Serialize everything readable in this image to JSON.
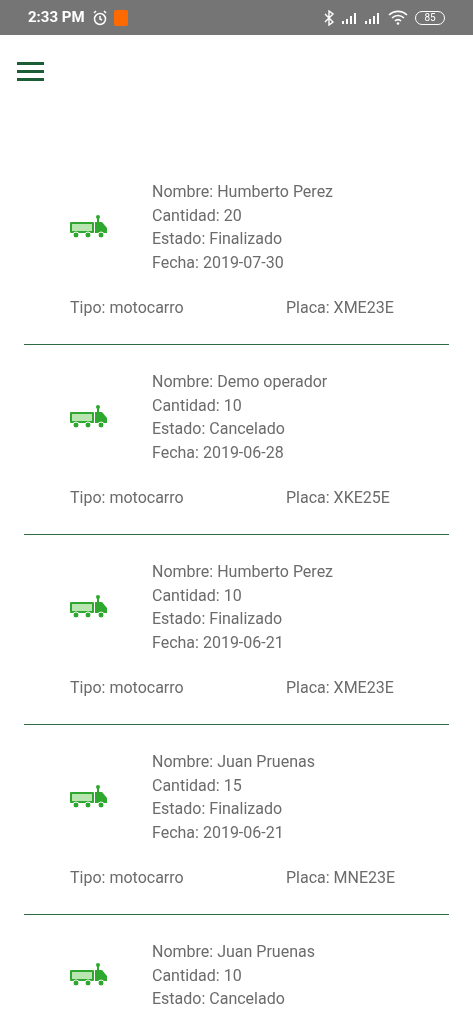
{
  "status_bar": {
    "time": "2:33 PM",
    "battery": "85"
  },
  "orders": [
    {
      "nombre": "Nombre: Humberto Perez",
      "cantidad": "Cantidad: 20",
      "estado": "Estado: Finalizado",
      "fecha": "Fecha: 2019-07-30",
      "tipo": "Tipo: motocarro",
      "placa": "Placa: XME23E"
    },
    {
      "nombre": "Nombre: Demo operador",
      "cantidad": "Cantidad: 10",
      "estado": "Estado: Cancelado",
      "fecha": "Fecha: 2019-06-28",
      "tipo": "Tipo: motocarro",
      "placa": "Placa: XKE25E"
    },
    {
      "nombre": "Nombre: Humberto Perez",
      "cantidad": "Cantidad: 10",
      "estado": "Estado: Finalizado",
      "fecha": "Fecha: 2019-06-21",
      "tipo": "Tipo: motocarro",
      "placa": "Placa: XME23E"
    },
    {
      "nombre": "Nombre: Juan Pruenas",
      "cantidad": "Cantidad: 15",
      "estado": "Estado: Finalizado",
      "fecha": "Fecha: 2019-06-21",
      "tipo": "Tipo: motocarro",
      "placa": "Placa: MNE23E"
    },
    {
      "nombre": "Nombre: Juan Pruenas",
      "cantidad": "Cantidad: 10",
      "estado": "Estado: Cancelado"
    }
  ]
}
